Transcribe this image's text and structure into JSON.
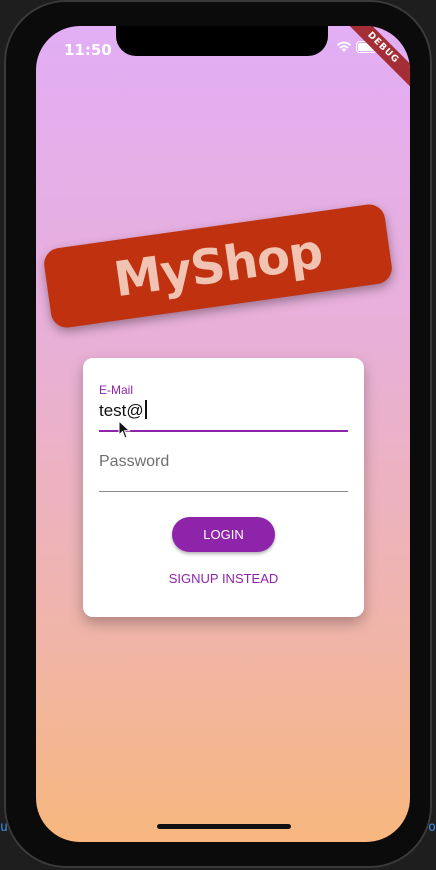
{
  "status_bar": {
    "time": "11:50",
    "wifi_icon": "wifi-icon",
    "battery_icon": "battery-icon"
  },
  "debug_banner": "DEBUG",
  "logo": {
    "title": "MyShop",
    "color": "#c0320f"
  },
  "auth_form": {
    "email": {
      "label": "E-Mail",
      "value": "test@"
    },
    "password": {
      "placeholder": "Password"
    },
    "login_label": "LOGIN",
    "signup_label": "SIGNUP INSTEAD"
  },
  "colors": {
    "accent": "#8e24aa",
    "gradient_top": "#e2aef5",
    "gradient_bottom": "#f7b77e"
  },
  "editor_fragments": {
    "left": "ucti",
    "right": "ro"
  }
}
